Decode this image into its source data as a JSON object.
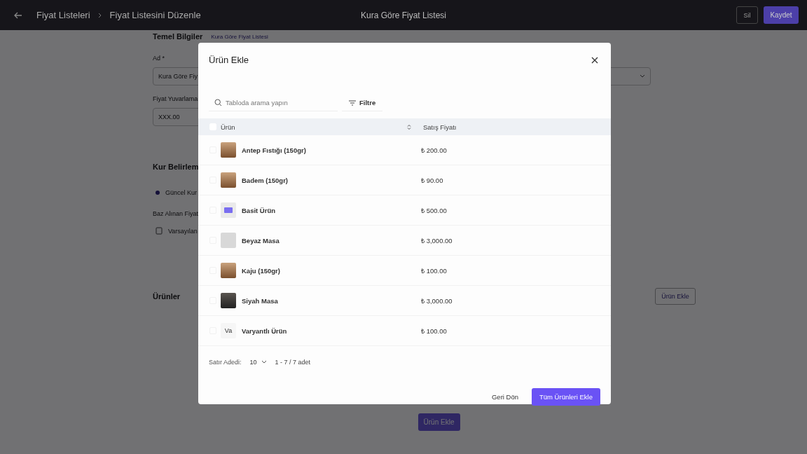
{
  "header": {
    "breadcrumbs": [
      "Fiyat Listeleri",
      "Fiyat Listesini Düzenle"
    ],
    "title": "Kura Göre Fiyat Listesi",
    "delete_button": "Sil",
    "save_button": "Kaydet"
  },
  "page": {
    "section_title": "Temel Bilgiler",
    "section_link": "Kura Göre Fiyat Listesi",
    "name_label": "Ad *",
    "name_value": "Kura Göre Fiy",
    "rounding_label": "Fiyat Yuvarlama",
    "rounding_value": "XXX.00",
    "rate_title": "Kur Belirlem",
    "rate_option": {
      "label": "Güncel Kur",
      "selected": true
    },
    "base_label": "Baz Alınan Fiyat",
    "base_value": "Varsayılan",
    "products_title": "Ürünler",
    "add_button_right": "Ürün Ekle",
    "add_button_bottom": "Ürün Ekle"
  },
  "modal": {
    "title": "Ürün Ekle",
    "search": {
      "placeholder": "Tabloda arama yapın"
    },
    "filter_button": "Filtre",
    "columns": [
      "Ürün",
      "Satış Fiyatı"
    ],
    "header_checked": false,
    "rows": [
      {
        "name": "Antep Fıstığı (150gr)",
        "price": "₺ 200.00",
        "kind": "photo",
        "checked": false
      },
      {
        "name": "Badem (150gr)",
        "price": "₺ 90.00",
        "kind": "photo",
        "checked": false
      },
      {
        "name": "Basit Ürün",
        "price": "₺ 500.00",
        "kind": "label",
        "checked": false
      },
      {
        "name": "Beyaz Masa",
        "price": "₺ 3,000.00",
        "kind": "light-photo",
        "checked": false
      },
      {
        "name": "Kaju (150gr)",
        "price": "₺ 100.00",
        "kind": "photo",
        "checked": false
      },
      {
        "name": "Siyah Masa",
        "price": "₺ 3,000.00",
        "kind": "dark-photo",
        "checked": false
      },
      {
        "name": "Varyantlı Ürün",
        "price": "₺ 100.00",
        "kind": "initials",
        "initials": "Va",
        "checked": false
      }
    ],
    "rows_label": "Satır Adedi:",
    "rows_value": "10",
    "range": "1 - 7 / 7 adet",
    "back_button": "Geri Dön",
    "add_all_button": "Tüm Ürünleri Ekle"
  }
}
